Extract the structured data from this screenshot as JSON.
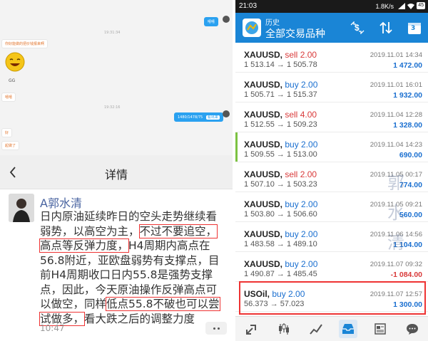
{
  "chat": {
    "bubble_top_right": "嘻嘻",
    "ts1": "19:31:34",
    "bubble_orange1": "你好能做的把价钱报来啊",
    "gg": "GG",
    "bubble_orange2": "嘻嘻",
    "ts2": "19:32:16",
    "bubble_right_value": "1480/1478/75",
    "bubble_right_tag": "看出来",
    "bubble_orange3": "好",
    "bubble_orange4": "起做了"
  },
  "detail": {
    "title": "详情",
    "author": "A郭水清",
    "text_parts": [
      "日内原油延续昨日的空头走势继续看弱势，以高空为主，",
      "不过不要追空，高点等反弹力度，",
      "H4周期内高点在56.8附近，亚欧盘弱势有支撑点，目前H4周期收口日内55.8是强势支撑点，因此，今天原油操作反弹高点可以做空，同样",
      "低点55.8不破也可以尝试做多，",
      "看大跌之后的调整力度"
    ],
    "time": "10:47"
  },
  "status": {
    "time": "21:03",
    "net": "1.8K/s",
    "battery": "45"
  },
  "app": {
    "subtitle": "历史",
    "title": "全部交易品种",
    "calendar_day": "3"
  },
  "trades": [
    {
      "symbol": "XAUUSD",
      "side": "sell",
      "volume": "2.00",
      "open": "1 513.14",
      "close": "1 505.78",
      "date": "2019.11.01 14:34",
      "profit": "1 472.00",
      "negative": false,
      "accent": ""
    },
    {
      "symbol": "XAUUSD",
      "side": "buy",
      "volume": "2.00",
      "open": "1 505.71",
      "close": "1 515.37",
      "date": "2019.11.01 16:01",
      "profit": "1 932.00",
      "negative": false,
      "accent": ""
    },
    {
      "symbol": "XAUUSD",
      "side": "sell",
      "volume": "4.00",
      "open": "1 512.55",
      "close": "1 509.23",
      "date": "2019.11.04 12:28",
      "profit": "1 328.00",
      "negative": false,
      "accent": ""
    },
    {
      "symbol": "XAUUSD",
      "side": "buy",
      "volume": "2.00",
      "open": "1 509.55",
      "close": "1 513.00",
      "date": "2019.11.04 14:23",
      "profit": "690.00",
      "negative": false,
      "accent": "#7cc242"
    },
    {
      "symbol": "XAUUSD",
      "side": "sell",
      "volume": "2.00",
      "open": "1 507.10",
      "close": "1 503.23",
      "date": "2019.11.05 00:17",
      "profit": "774.00",
      "negative": false,
      "accent": ""
    },
    {
      "symbol": "XAUUSD",
      "side": "buy",
      "volume": "2.00",
      "open": "1 503.80",
      "close": "1 506.60",
      "date": "2019.11.05 09:21",
      "profit": "560.00",
      "negative": false,
      "accent": ""
    },
    {
      "symbol": "XAUUSD",
      "side": "buy",
      "volume": "2.00",
      "open": "1 483.58",
      "close": "1 489.10",
      "date": "2019.11.06 14:56",
      "profit": "1 104.00",
      "negative": false,
      "accent": ""
    },
    {
      "symbol": "XAUUSD",
      "side": "buy",
      "volume": "2.00",
      "open": "1 490.87",
      "close": "1 485.45",
      "date": "2019.11.07 09:32",
      "profit": "-1 084.00",
      "negative": true,
      "accent": ""
    },
    {
      "symbol": "USOil",
      "side": "buy",
      "volume": "2.00",
      "open": "56.373",
      "close": "57.023",
      "date": "2019.11.07 12:57",
      "profit": "1 300.00",
      "negative": false,
      "accent": ""
    }
  ],
  "watermark": [
    "郭",
    "水",
    "清"
  ],
  "colors": {
    "accent": "#1a85d6",
    "sell": "#d93a3a",
    "buy": "#1a6fd0",
    "highlight": "#e33333"
  },
  "nav_icons": [
    "trade-icon",
    "candles-icon",
    "chart-icon",
    "history-inbox-icon",
    "news-icon",
    "chat-icon"
  ]
}
